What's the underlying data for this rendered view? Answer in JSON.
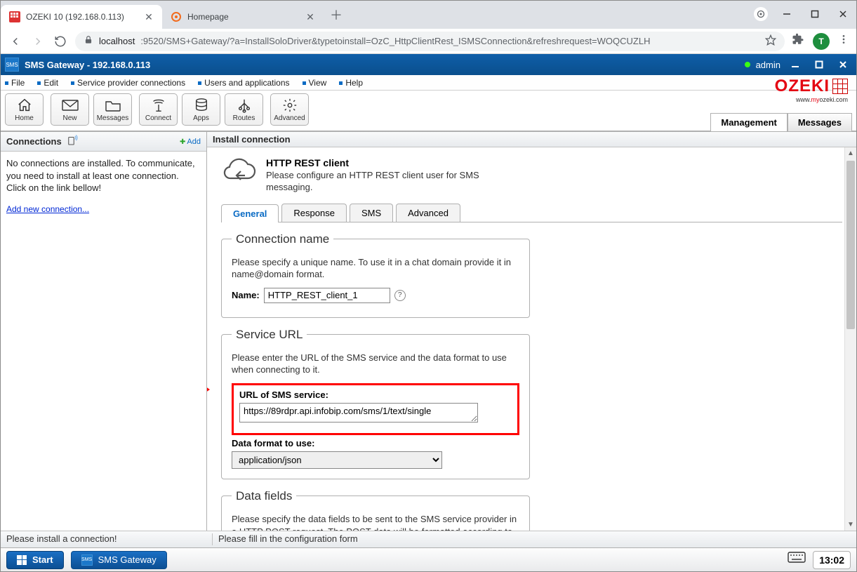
{
  "browser": {
    "tabs": [
      {
        "title": "OZEKI 10 (192.168.0.113)",
        "active": true
      },
      {
        "title": "Homepage",
        "active": false
      }
    ],
    "url_prefix": "localhost",
    "url_rest": ":9520/SMS+Gateway/?a=InstallSoloDriver&typetoinstall=OzC_HttpClientRest_ISMSConnection&refreshrequest=WOQCUZLH",
    "avatar_letter": "T"
  },
  "app": {
    "title": "SMS Gateway  -  192.168.0.113",
    "user": "admin"
  },
  "menus": [
    "File",
    "Edit",
    "Service provider connections",
    "Users and applications",
    "View",
    "Help"
  ],
  "toolbar": [
    {
      "id": "home",
      "label": "Home"
    },
    {
      "id": "new",
      "label": "New"
    },
    {
      "id": "messages",
      "label": "Messages"
    },
    {
      "id": "connect",
      "label": "Connect"
    },
    {
      "id": "apps",
      "label": "Apps"
    },
    {
      "id": "routes",
      "label": "Routes"
    },
    {
      "id": "advanced",
      "label": "Advanced"
    }
  ],
  "logo": {
    "brand": "OZEKI",
    "sub_pre": "www.",
    "sub_my": "my",
    "sub_post": "ozeki.com"
  },
  "right_tabs": {
    "management": "Management",
    "messages": "Messages"
  },
  "left": {
    "title": "Connections",
    "add": "Add",
    "body": "No connections are installed. To communicate, you need to install at least one connection. Click on the link bellow!",
    "link": "Add new connection..."
  },
  "install": {
    "title": "Install connection",
    "driver_name": "HTTP REST client",
    "driver_desc": "Please configure an HTTP REST client user for SMS messaging.",
    "tabs": [
      "General",
      "Response",
      "SMS",
      "Advanced"
    ],
    "conn_name": {
      "legend": "Connection name",
      "hint": "Please specify a unique name. To use it in a chat domain provide it in name@domain format.",
      "label": "Name:",
      "value": "HTTP_REST_client_1"
    },
    "service": {
      "legend": "Service URL",
      "hint": "Please enter the URL of the SMS service and the data format to use when connecting to it.",
      "url_label": "URL of SMS service:",
      "url_value": "https://89rdpr.api.infobip.com/sms/1/text/single",
      "fmt_label": "Data format to use:",
      "fmt_value": "application/json"
    },
    "datafields": {
      "legend": "Data fields",
      "hint": "Please specify the data fields to be sent to the SMS service provider in a HTTP POST request. The POST data will be formatted according to the specified data"
    }
  },
  "status": {
    "left": "Please install a connection!",
    "right": "Please fill in the configuration form"
  },
  "taskbar": {
    "start": "Start",
    "app": "SMS Gateway",
    "clock": "13:02"
  }
}
